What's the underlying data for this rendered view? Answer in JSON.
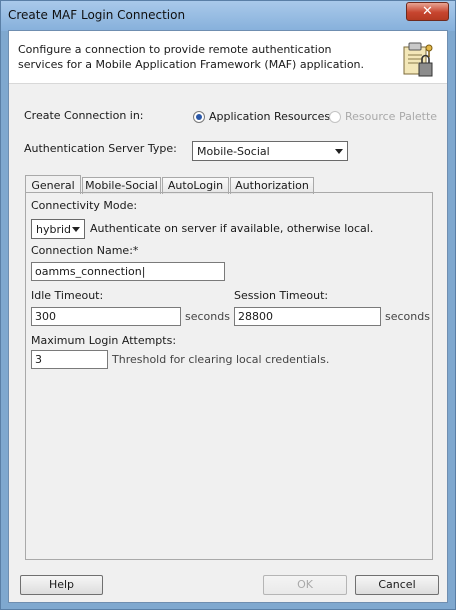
{
  "window": {
    "title": "Create MAF Login Connection",
    "close_glyph": "✕"
  },
  "header": {
    "description": "Configure a connection to provide remote authentication services for a Mobile Application Framework (MAF) application.",
    "icon": "connection-wizard-icon"
  },
  "create_in": {
    "label": "Create Connection in:",
    "options": [
      {
        "label": "Application Resources",
        "selected": true,
        "enabled": true
      },
      {
        "label": "Resource Palette",
        "selected": false,
        "enabled": false
      }
    ]
  },
  "auth_server": {
    "label": "Authentication Server Type:",
    "value": "Mobile-Social"
  },
  "tabs": [
    {
      "label": "General",
      "active": true
    },
    {
      "label": "Mobile-Social",
      "active": false
    },
    {
      "label": "AutoLogin",
      "active": false
    },
    {
      "label": "Authorization",
      "active": false
    }
  ],
  "general": {
    "connectivity_mode": {
      "label": "Connectivity Mode:",
      "value": "hybrid",
      "hint": "Authenticate on server if available, otherwise local."
    },
    "connection_name": {
      "label": "Connection Name:*",
      "value": "oamms_connection"
    },
    "idle_timeout": {
      "label": "Idle Timeout:",
      "value": "300",
      "unit": "seconds"
    },
    "session_timeout": {
      "label": "Session Timeout:",
      "value": "28800",
      "unit": "seconds"
    },
    "max_login_attempts": {
      "label": "Maximum Login Attempts:",
      "value": "3",
      "hint": "Threshold for clearing local credentials."
    }
  },
  "buttons": {
    "help": "Help",
    "ok": "OK",
    "cancel": "Cancel"
  },
  "colors": {
    "title_bar": "#9ebfe3",
    "close_button": "#c7452f",
    "radio_selected": "#2b58a8"
  }
}
